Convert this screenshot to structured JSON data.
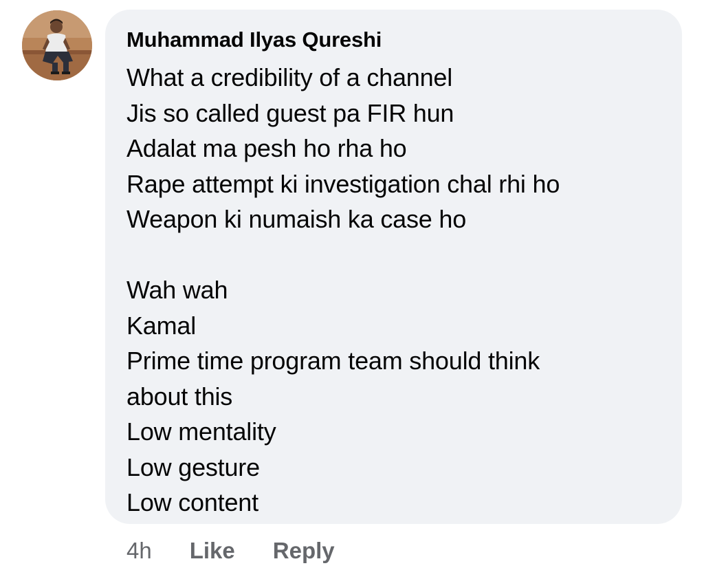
{
  "comment": {
    "author": "Muhammad Ilyas Qureshi",
    "lines": [
      "What a credibility of a channel",
      "Jis so called guest pa FIR hun",
      "Adalat ma pesh ho rha ho",
      "Rape attempt ki investigation chal rhi ho",
      "Weapon ki numaish ka case ho",
      "",
      "Wah wah",
      "Kamal",
      "Prime time program team should think",
      "about this",
      "Low mentality",
      "Low gesture",
      "Low content"
    ],
    "timestamp": "4h",
    "like_label": "Like",
    "reply_label": "Reply"
  },
  "colors": {
    "bubble_background": "#f0f2f5",
    "text": "#050505",
    "secondary_text": "#65676b"
  }
}
